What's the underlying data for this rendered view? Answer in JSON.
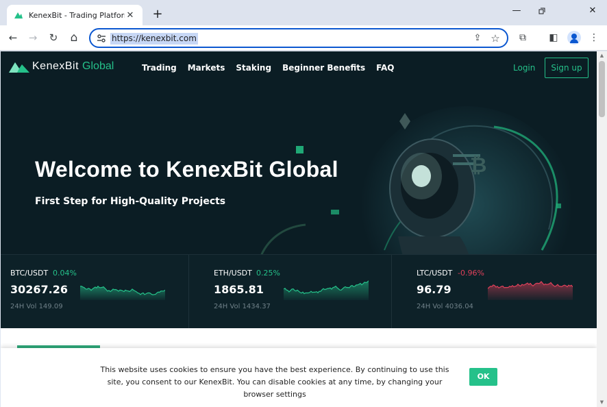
{
  "browser": {
    "tab_title": "KenexBit - Trading Platform",
    "tab_close": "✕",
    "new_tab": "+",
    "url": "https://kenexbit.com",
    "window_controls": {
      "minimize": "—",
      "maximize": "☐",
      "close": "✕"
    }
  },
  "site": {
    "logo_text": "KenexBit",
    "logo_accent": "Global",
    "nav": [
      "Trading",
      "Markets",
      "Staking",
      "Beginner Benefits",
      "FAQ"
    ],
    "login": "Login",
    "signup": "Sign up"
  },
  "hero": {
    "title": "Welcome to KenexBit Global",
    "subtitle": "First Step for High-Quality Projects"
  },
  "tickers": [
    {
      "pair": "BTC/USDT",
      "change": "0.04%",
      "price": "30267.26",
      "volume": "24H Vol 149.09",
      "direction": "up"
    },
    {
      "pair": "ETH/USDT",
      "change": "0.25%",
      "price": "1865.81",
      "volume": "24H Vol 1434.37",
      "direction": "up"
    },
    {
      "pair": "LTC/USDT",
      "change": "-0.96%",
      "price": "96.79",
      "volume": "24H Vol 4036.04",
      "direction": "down"
    }
  ],
  "cookie": {
    "text": "This website uses cookies to ensure you have the best experience. By continuing to use this site, you consent to our KenexBit. You can disable cookies at any time, by changing your browser settings",
    "ok": "OK"
  },
  "colors": {
    "accent": "#25c18a",
    "down": "#e0405a",
    "hero_bg": "#0b1d24"
  },
  "icons": {
    "back": "←",
    "forward": "→",
    "reload": "↻",
    "home": "⌂",
    "share": "⇪",
    "star": "☆",
    "extensions": "⧉",
    "sidepanel": "◧",
    "menu": "⋮",
    "site_info": "⚙"
  }
}
